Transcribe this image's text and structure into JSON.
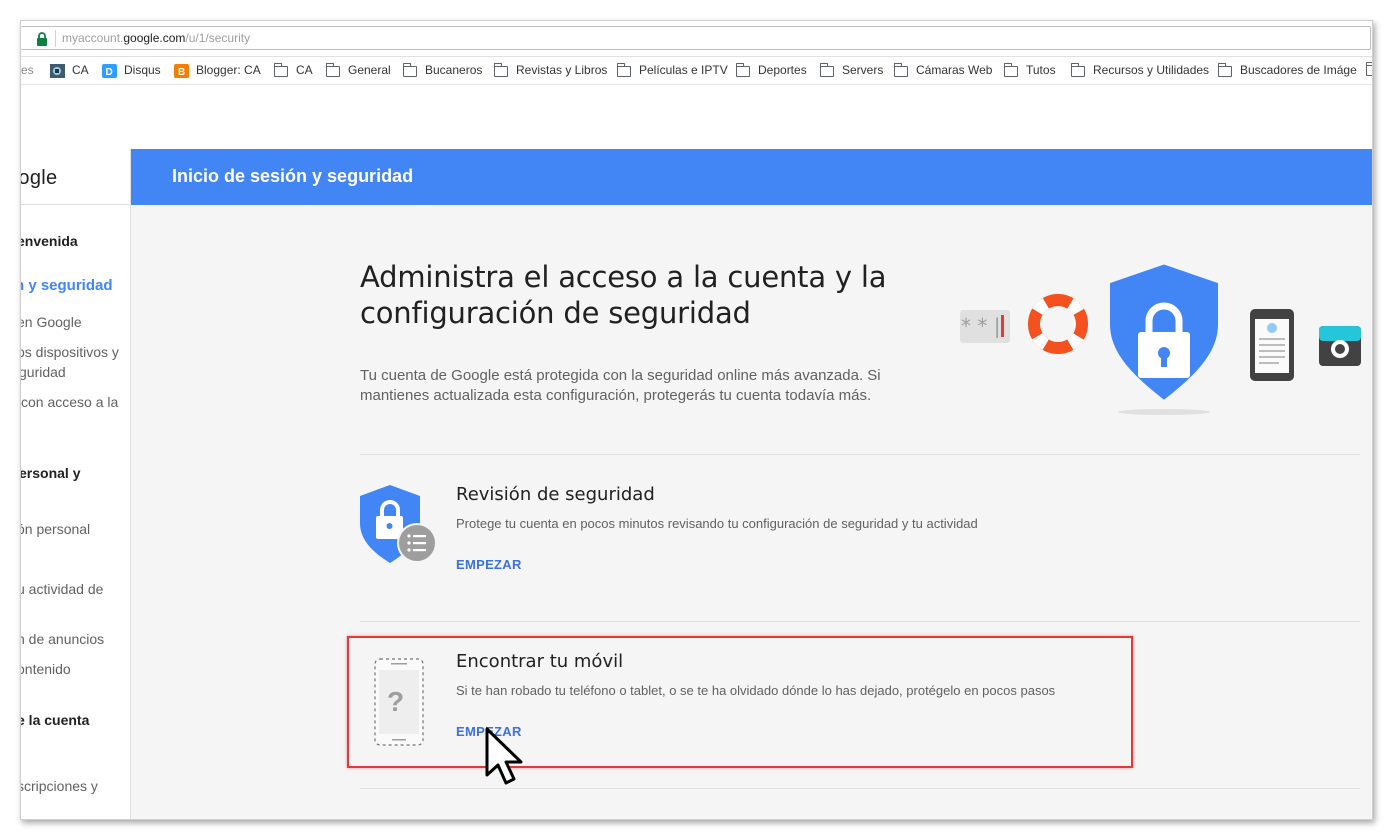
{
  "browser": {
    "url_prefix": "myaccount.",
    "url_host": "google.com",
    "url_path": "/u/1/security"
  },
  "bookmarks": [
    {
      "label": "res",
      "icon": "none"
    },
    {
      "label": "CA",
      "icon": "site-icon"
    },
    {
      "label": "Disqus",
      "icon": "disqus-icon"
    },
    {
      "label": "Blogger: CA",
      "icon": "blogger-icon"
    },
    {
      "label": "CA",
      "icon": "folder-icon"
    },
    {
      "label": "General",
      "icon": "folder-icon"
    },
    {
      "label": "Bucaneros",
      "icon": "folder-icon"
    },
    {
      "label": "Revistas y Libros",
      "icon": "folder-icon"
    },
    {
      "label": "Películas e IPTV",
      "icon": "folder-icon"
    },
    {
      "label": "Deportes",
      "icon": "folder-icon"
    },
    {
      "label": "Servers",
      "icon": "folder-icon"
    },
    {
      "label": "Cámaras Web",
      "icon": "folder-icon"
    },
    {
      "label": "Tutos",
      "icon": "folder-icon"
    },
    {
      "label": "Recursos y Utilidades",
      "icon": "folder-icon"
    },
    {
      "label": "Buscadores de Imáge",
      "icon": "folder-icon"
    }
  ],
  "sidebar": {
    "logo": "oogle",
    "items": [
      {
        "label": "envenida"
      },
      {
        "label": "n y seguridad"
      },
      {
        "label": " en Google"
      },
      {
        "label": "os dispositivos y"
      },
      {
        "label": "guridad"
      },
      {
        "label": "con acceso a la"
      },
      {
        "label": "ersonal y"
      },
      {
        "label": "ón personal"
      },
      {
        "label": "u actividad de"
      },
      {
        "label": "n de anuncios"
      },
      {
        "label": "ontenido"
      },
      {
        "label": "e la cuenta"
      },
      {
        "label": "scripciones y"
      }
    ]
  },
  "header": {
    "title": "Inicio de sesión y seguridad"
  },
  "main": {
    "title": "Administra el acceso a la cuenta y la configuración de seguridad",
    "description": "Tu cuenta de Google está protegida con la seguridad online más avanzada. Si mantienes actualizada esta configuración, protegerás tu cuenta todavía más.",
    "hero_password_text": "* * |"
  },
  "cards": [
    {
      "title": "Revisión de seguridad",
      "description": "Protege tu cuenta en pocos minutos revisando tu configuración de seguridad y tu actividad",
      "action": "EMPEZAR"
    },
    {
      "title": "Encontrar tu móvil",
      "description": "Si te han robado tu teléfono o tablet, o se te ha olvidado dónde lo has dejado, protégelo en pocos pasos",
      "action": "EMPEZAR"
    }
  ],
  "colors": {
    "accent_blue": "#4285f4",
    "link_blue": "#3b72dd",
    "highlight_red": "#e53935",
    "lifebuoy_orange": "#f4511e",
    "camera_teal": "#26c6da"
  }
}
